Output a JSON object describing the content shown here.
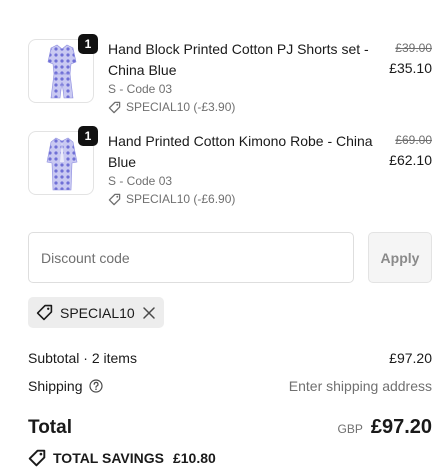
{
  "cart": {
    "items": [
      {
        "quantity": "1",
        "name": "Hand Block Printed Cotton PJ Shorts set - China Blue",
        "variant": "S - Code 03",
        "discount": "SPECIAL10 (-£3.90)",
        "original_price": "£39.00",
        "price": "£35.10"
      },
      {
        "quantity": "1",
        "name": "Hand Printed Cotton Kimono Robe - China Blue",
        "variant": "S - Code 03",
        "discount": "SPECIAL10 (-£6.90)",
        "original_price": "£69.00",
        "price": "£62.10"
      }
    ]
  },
  "discount_form": {
    "placeholder": "Discount code",
    "value": "",
    "apply_label": "Apply"
  },
  "applied_code": "SPECIAL10",
  "summary": {
    "subtotal_label": "Subtotal · 2 items",
    "subtotal_value": "£97.20",
    "shipping_label": "Shipping",
    "shipping_value": "Enter shipping address",
    "total_label": "Total",
    "currency": "GBP",
    "total_value": "£97.20",
    "savings_label": "TOTAL SAVINGS",
    "savings_value": "£10.80"
  },
  "icons": {
    "tag": "tag-icon",
    "close": "close-icon",
    "help": "question-circle-icon"
  },
  "colors": {
    "accent": "#111111",
    "muted_text": "#707070",
    "product_print": "#6f6fd6"
  }
}
